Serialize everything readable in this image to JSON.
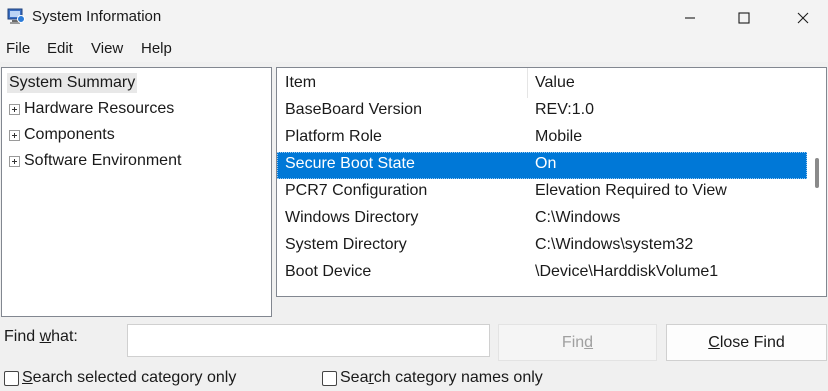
{
  "window": {
    "title": "System Information",
    "app_icon": "system-information-icon",
    "controls": {
      "minimize": "minimize-icon",
      "maximize": "maximize-icon",
      "close": "close-icon"
    }
  },
  "menu": [
    "File",
    "Edit",
    "View",
    "Help"
  ],
  "tree": {
    "root": "System Summary",
    "children": [
      "Hardware Resources",
      "Components",
      "Software Environment"
    ]
  },
  "list": {
    "columns": [
      "Item",
      "Value"
    ],
    "rows": [
      {
        "item": "BaseBoard Version",
        "value": "REV:1.0"
      },
      {
        "item": "Platform Role",
        "value": "Mobile"
      },
      {
        "item": "Secure Boot State",
        "value": "On",
        "selected": true
      },
      {
        "item": "PCR7 Configuration",
        "value": "Elevation Required to View"
      },
      {
        "item": "Windows Directory",
        "value": "C:\\Windows"
      },
      {
        "item": "System Directory",
        "value": "C:\\Windows\\system32"
      },
      {
        "item": "Boot Device",
        "value": "\\Device\\HarddiskVolume1"
      }
    ],
    "selection_color": "#0078d7"
  },
  "find": {
    "label_before": "Find ",
    "label_accel": "w",
    "label_after": "hat:",
    "input_value": "",
    "find_button_before": "Fin",
    "find_button_accel": "d",
    "close_button_accel": "C",
    "close_button_after": "lose Find",
    "checkbox1_accel": "S",
    "checkbox1_after": "earch selected category only",
    "checkbox1_checked": false,
    "checkbox2_before": "Sea",
    "checkbox2_accel": "r",
    "checkbox2_after": "ch category names only",
    "checkbox2_checked": false
  }
}
